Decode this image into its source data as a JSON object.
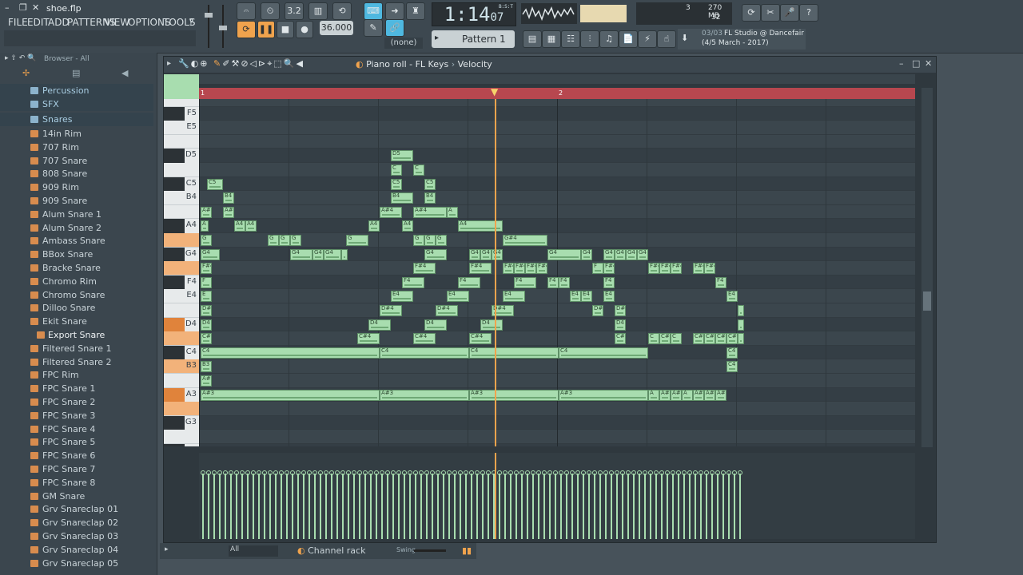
{
  "app": {
    "file_title": "shoe.flp"
  },
  "menu": [
    "FILE",
    "EDIT",
    "ADD",
    "PATTERNS",
    "VIEW",
    "OPTIONS",
    "TOOLS",
    "?"
  ],
  "transport": {
    "time": "1:14",
    "time_sub": "07",
    "time_unit": "B:S:T",
    "tempo": "36.000",
    "pattern": "Pattern 1",
    "snap": "(none)",
    "cpu_value": "3",
    "memory": "270 MB",
    "polyphony": "32",
    "hint_count": "03/03",
    "hint_title": "FL Studio @ Dancefair",
    "hint_date": "(4/5 March - 2017)"
  },
  "browser": {
    "title": "Browser - All",
    "folders": [
      "Percussion",
      "SFX",
      "Snares"
    ],
    "items": [
      "14in Rim",
      "707 Rim",
      "707 Snare",
      "808 Snare",
      "909 Rim",
      "909 Snare",
      "Alum Snare 1",
      "Alum Snare 2",
      "Ambass Snare",
      "BBox Snare",
      "Bracke Snare",
      "Chromo Rim",
      "Chromo Snare",
      "Dilloo Snare",
      "Ekit Snare",
      "Export Snare",
      "Filtered Snare 1",
      "Filtered Snare 2",
      "FPC Rim",
      "FPC Snare 1",
      "FPC Snare 2",
      "FPC Snare 3",
      "FPC Snare 4",
      "FPC Snare 5",
      "FPC Snare 6",
      "FPC Snare 7",
      "FPC Snare 8",
      "GM Snare",
      "Grv Snareclap 01",
      "Grv Snareclap 02",
      "Grv Snareclap 03",
      "Grv Snareclap 04",
      "Grv Snareclap 05"
    ]
  },
  "piano_roll": {
    "title": "Piano roll - FL Keys",
    "breadcrumb_sep": "›",
    "target": "Velocity",
    "bar_markers": [
      "1",
      "2"
    ],
    "key_labels": [
      "F5",
      "E5",
      "D5",
      "C5",
      "B4",
      "A4",
      "G4",
      "F4",
      "E4",
      "D4",
      "C4",
      "B3",
      "A3",
      "G3"
    ]
  },
  "channel_rack": {
    "label": "Channel rack",
    "filter": "All",
    "swing_label": "Swing"
  },
  "colors": {
    "accent": "#f0a34d",
    "note": "#a8ddaf",
    "ruler": "#b7474f"
  }
}
